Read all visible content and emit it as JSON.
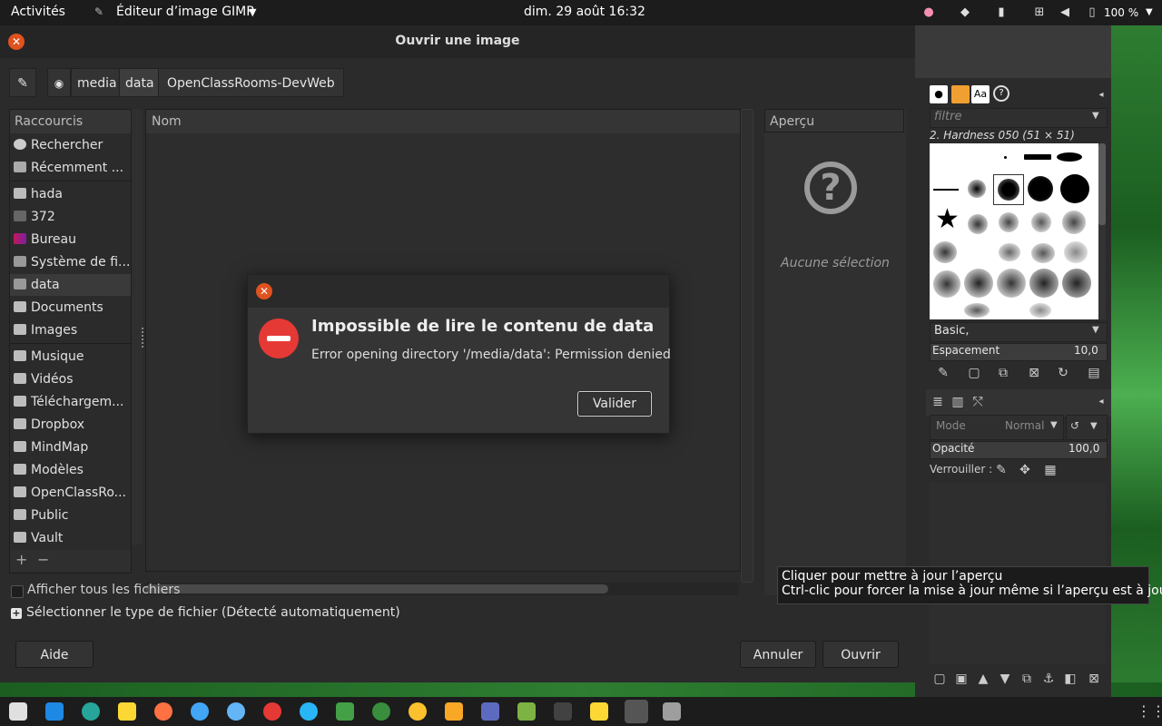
{
  "topbar": {
    "activities": "Activités",
    "app_menu": "Éditeur d’image GIMP",
    "clock": "dim. 29 août  16:32",
    "battery": "100 %"
  },
  "dialog": {
    "title": "Ouvrir une image",
    "path": [
      "media",
      "data",
      "OpenClassRooms-DevWeb"
    ],
    "sidebar": {
      "header": "Raccourcis",
      "items": [
        {
          "label": "Rechercher",
          "icon": "search-icon"
        },
        {
          "label": "Récemment ...",
          "icon": "recent-icon"
        },
        {
          "label": "hada",
          "icon": "folder-icon"
        },
        {
          "label": "372",
          "icon": "folder-icon"
        },
        {
          "label": "Bureau",
          "icon": "desktop-icon"
        },
        {
          "label": "Système de fi...",
          "icon": "drive-icon"
        },
        {
          "label": "data",
          "icon": "drive-icon"
        },
        {
          "label": "Documents",
          "icon": "folder-icon"
        },
        {
          "label": "Images",
          "icon": "folder-icon"
        },
        {
          "label": "Musique",
          "icon": "folder-icon"
        },
        {
          "label": "Vidéos",
          "icon": "folder-icon"
        },
        {
          "label": "Téléchargem...",
          "icon": "folder-icon"
        },
        {
          "label": "Dropbox",
          "icon": "folder-icon"
        },
        {
          "label": "MindMap",
          "icon": "folder-icon"
        },
        {
          "label": "Modèles",
          "icon": "folder-icon"
        },
        {
          "label": "OpenClassRo...",
          "icon": "folder-icon"
        },
        {
          "label": "Public",
          "icon": "folder-icon"
        },
        {
          "label": "Vault",
          "icon": "folder-icon"
        }
      ]
    },
    "column_name": "Nom",
    "preview_header": "Aperçu",
    "no_selection": "Aucune sélection",
    "show_all_files": "Afficher tous les fichiers",
    "file_type": "Sélectionner le type de fichier (Détecté automatiquement)",
    "help_button": "Aide",
    "cancel_button": "Annuler",
    "open_button": "Ouvrir"
  },
  "error": {
    "title": "Impossible de lire le contenu de data",
    "message": "Error opening directory '/media/data': Permission denied",
    "ok_button": "Valider"
  },
  "gimp": {
    "filter_placeholder": "filtre",
    "brush_name": "2. Hardness 050 (51 × 51)",
    "preset": "Basic,",
    "spacing_label": "Espacement",
    "spacing_value": "10,0",
    "mode_label": "Mode",
    "mode_value": "Normal",
    "opacity_label": "Opacité",
    "opacity_value": "100,0",
    "lock_label": "Verrouiller :"
  },
  "tooltip": {
    "line1": "Cliquer pour mettre à jour l’aperçu",
    "line2": "Ctrl-clic pour forcer la mise à jour même si l’aperçu est à jour"
  },
  "colors": {
    "accent_close": "#e0521f",
    "error_red": "#e53935",
    "window_bg": "#2b2b2b"
  }
}
